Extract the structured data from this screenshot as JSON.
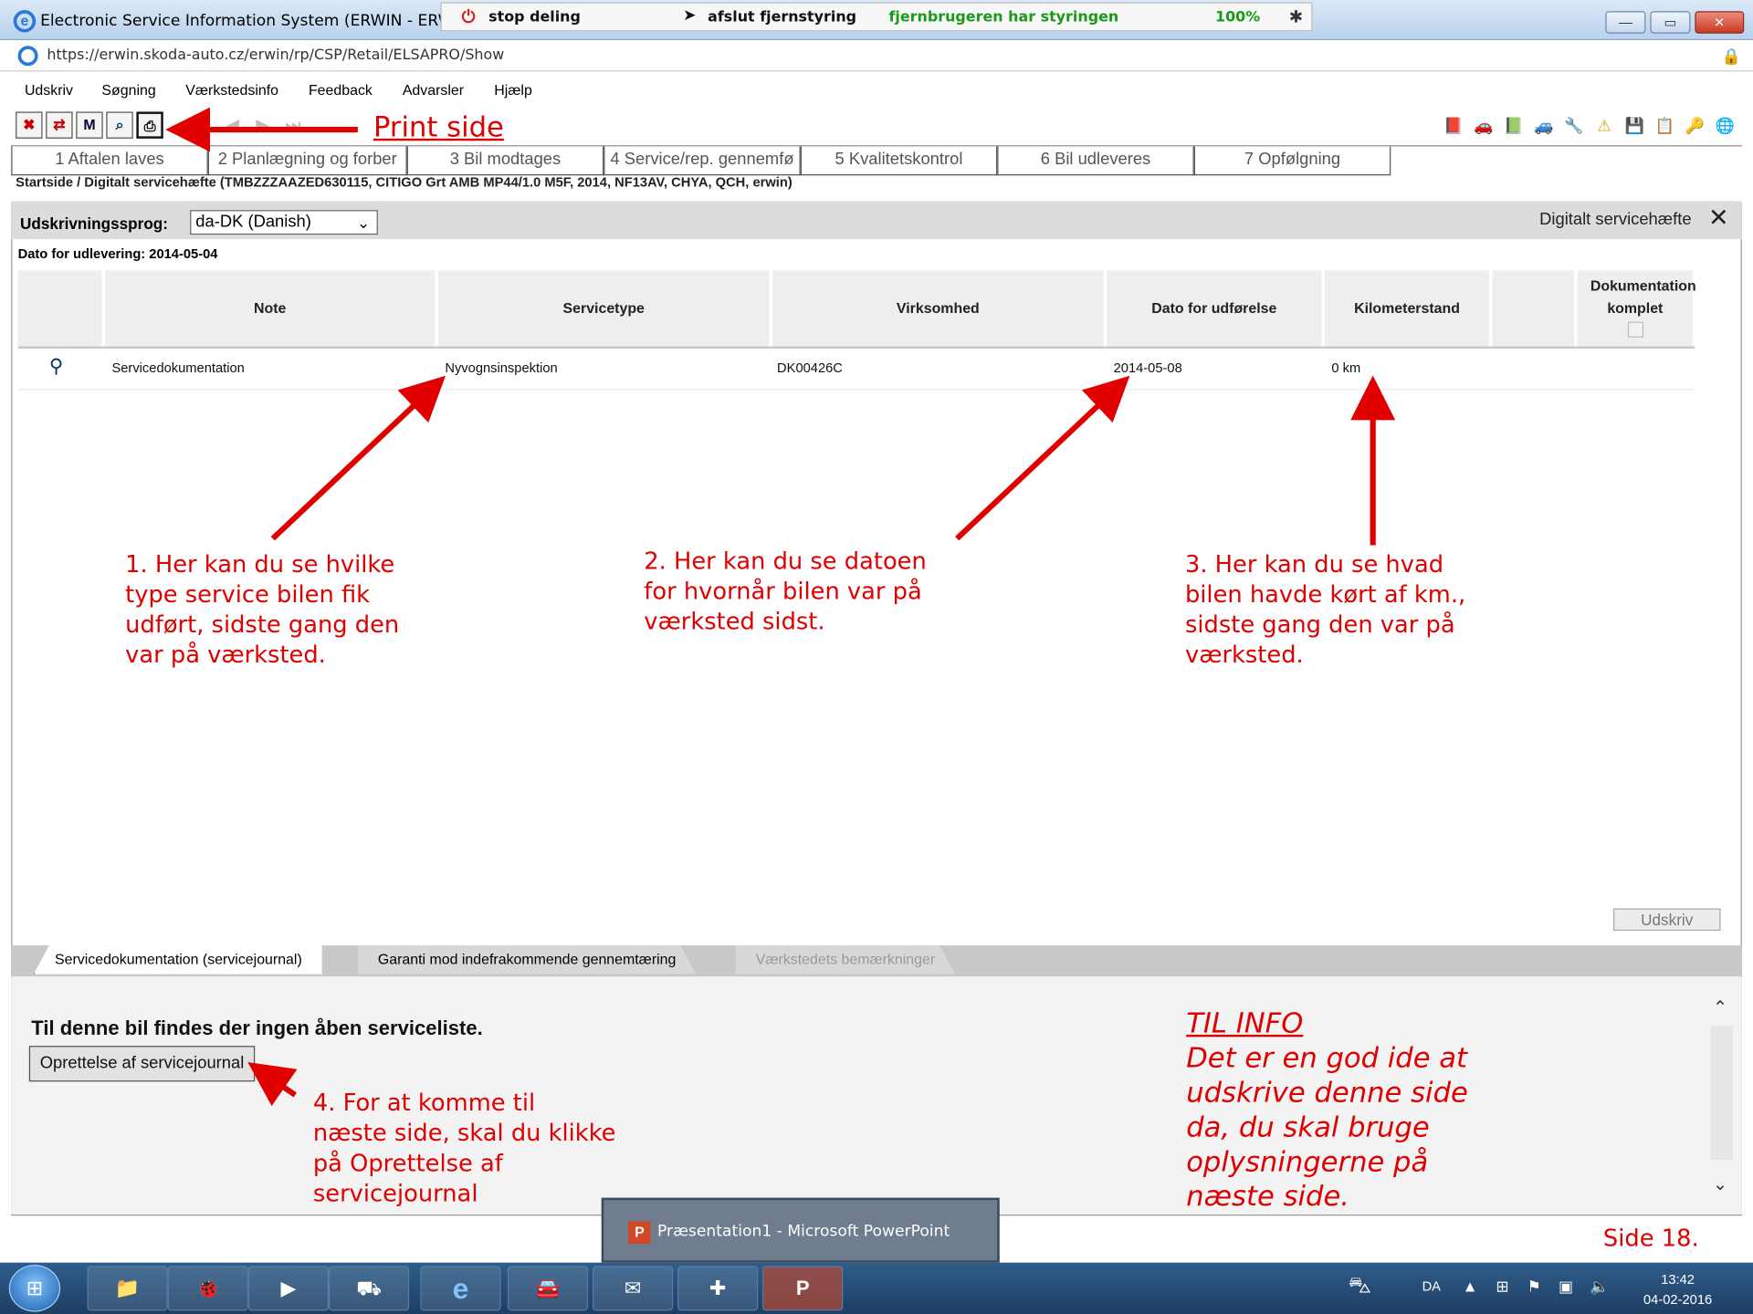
{
  "window": {
    "title": "Electronic Service Information System (ERWIN - ERWIN)",
    "url": "https://erwin.skoda-auto.cz/erwin/rp/CSP/Retail/ELSAPRO/Show",
    "ie_logo": "e"
  },
  "remote": {
    "stop_label": "stop deling",
    "release_label": "afslut fjernstyring",
    "status": "fjernbrugeren har styringen",
    "zoom": "100%"
  },
  "menu": [
    "Udskriv",
    "Søgning",
    "Værkstedsinfo",
    "Feedback",
    "Advarsler",
    "Hjælp"
  ],
  "toolbar": {
    "left_icons": [
      "close-doc-icon",
      "swap-icon",
      "calendar-icon",
      "search-icon",
      "print-icon"
    ],
    "left_glyphs": [
      "✖",
      "⇄",
      "M",
      "⌕",
      "⎙"
    ],
    "nav_glyphs": [
      "⏮",
      "◀",
      "▶",
      "⏭"
    ],
    "right_glyphs": [
      "📕",
      "🚗",
      "📗",
      "🚙",
      "🔧",
      "⚠",
      "💾",
      "📋",
      "🔑",
      "🌐"
    ]
  },
  "steps": [
    "1 Aftalen laves",
    "2 Planlægning og forber",
    "3 Bil modtages",
    "4 Service/rep. gennemfø",
    "5 Kvalitetskontrol",
    "6 Bil udleveres",
    "7 Opfølgning"
  ],
  "breadcrumb": "Startside / Digitalt servicehæfte (TMBZZZAAZED630115, CITIGO Grt AMB MP44/1.0 M5F, 2014, NF13AV, CHYA, QCH, erwin)",
  "panel": {
    "lang_label": "Udskrivningssprog:",
    "lang_value": "da-DK (Danish)",
    "title": "Digitalt servicehæfte",
    "close": "✕",
    "delivery": "Dato for udlevering: 2014-05-04"
  },
  "table": {
    "headers": [
      "Note",
      "Servicetype",
      "Virksomhed",
      "Dato for udførelse",
      "Kilometerstand",
      "Dokumentation komplet"
    ],
    "row": {
      "note": "Servicedokumentation",
      "servicetype": "Nyvognsinspektion",
      "company": "DK00426C",
      "date": "2014-05-08",
      "km": "0 km"
    }
  },
  "buttons": {
    "udskriv": "Udskriv",
    "create_journal": "Oprettelse af servicejournal"
  },
  "bottom_tabs": [
    "Servicedokumentation (servicejournal)",
    "Garanti mod indefrakommende gennemtæring",
    "Værkstedets bemærkninger"
  ],
  "no_list": "Til denne bil findes der ingen åben serviceliste.",
  "annotations": {
    "print_side": "Print side",
    "a1": [
      "1. Her kan du se hvilke",
      "type service bilen fik",
      "udført, sidste gang den",
      "var på værksted."
    ],
    "a2": [
      "2. Her kan du se datoen",
      "for hvornår bilen var på",
      "værksted sidst."
    ],
    "a3": [
      "3. Her kan du se hvad",
      "bilen havde kørt af km.,",
      "sidste gang den var på",
      "værksted."
    ],
    "a4": [
      "4. For at komme til",
      "næste side, skal du klikke",
      "på Oprettelse af",
      "servicejournal"
    ],
    "info_title": "TIL INFO",
    "info_lines": [
      "Det er en god ide at",
      "udskrive denne side",
      "da, du skal bruge",
      "oplysningerne på",
      "næste side."
    ],
    "page_num": "Side 18."
  },
  "popup": {
    "title": "Præsentation1 - Microsoft PowerPoint",
    "icon": "P"
  },
  "taskbar": {
    "buttons": [
      "📁",
      "🐞",
      "▶",
      "⛟",
      "e",
      "🚘",
      "✉",
      "✚",
      "P"
    ],
    "lang": "DA",
    "time": "13:42",
    "date": "04-02-2016"
  },
  "colors": {
    "annotation": "#e00000",
    "status_green": "#1a9a1a"
  }
}
